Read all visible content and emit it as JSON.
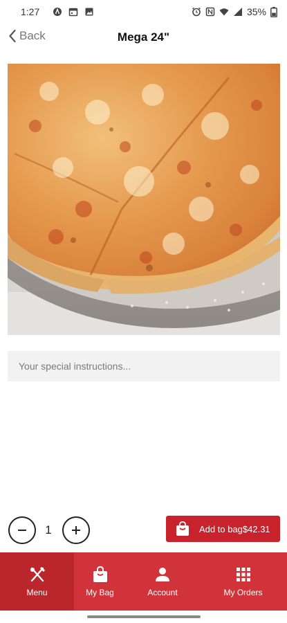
{
  "status_bar": {
    "time": "1:27",
    "battery": "35%",
    "left_icons": [
      "assistant-icon",
      "calendar-icon",
      "photo-icon"
    ],
    "right_icons": [
      "alarm-icon",
      "nfc-icon",
      "wifi-icon",
      "signal-icon",
      "battery-icon"
    ]
  },
  "header": {
    "back_label": "Back",
    "title": "Mega 24\""
  },
  "image": {
    "subject": "pizza-photo"
  },
  "instructions": {
    "placeholder": "Your special instructions..."
  },
  "quantity": {
    "value": "1"
  },
  "add_button": {
    "label": "Add to bag",
    "price": "$42.31"
  },
  "bottom_nav": {
    "active": "Menu",
    "items": [
      {
        "label": "Menu",
        "icon": "fork-knife-icon"
      },
      {
        "label": "My Bag",
        "icon": "bag-icon"
      },
      {
        "label": "Account",
        "icon": "person-icon"
      },
      {
        "label": "My Orders",
        "icon": "grid-icon"
      }
    ]
  },
  "colors": {
    "brand_red": "#d0343a",
    "brand_red_dark": "#b9262c",
    "button_red": "#c8232c"
  }
}
